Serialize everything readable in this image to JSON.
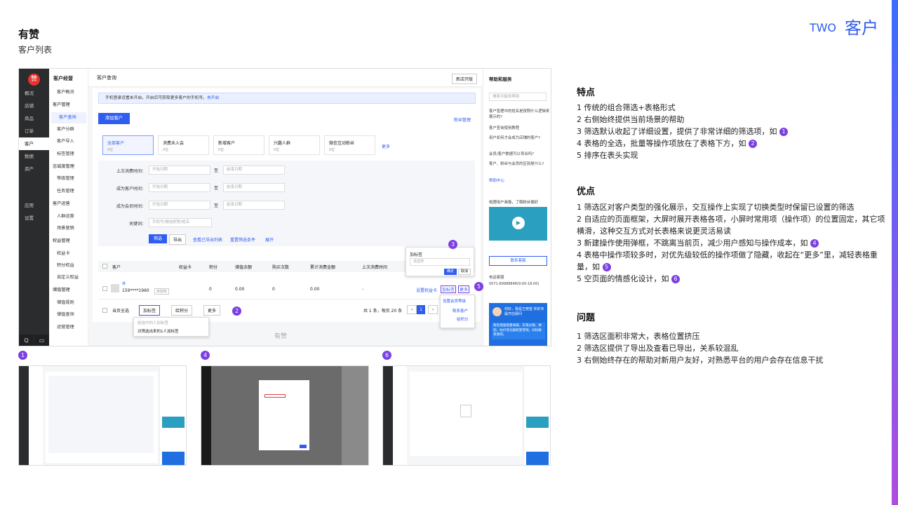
{
  "header": {
    "brand": "有赞",
    "subtitle": "客户列表",
    "tag_en": "TWO",
    "tag_cn": "客户"
  },
  "nav": {
    "logo": "赞",
    "items": [
      "概况",
      "店铺",
      "商品",
      "订单",
      "客户",
      "数据",
      "资产",
      "应用",
      "设置"
    ],
    "bottom": [
      "Q",
      "▭"
    ]
  },
  "sub": {
    "title": "客户经营",
    "items": [
      "客户概况",
      "客户管理",
      "客户查询",
      "客户分群",
      "客户导入",
      "标签管理",
      "忠诚度管理",
      "等级管理",
      "任务管理",
      "客户运营",
      "人群运营",
      "场景营销",
      "权益管理",
      "权益卡",
      "积分权益",
      "自定义权益",
      "储值管理",
      "储值规则",
      "储值查询",
      "运营管理"
    ]
  },
  "content": {
    "crumb": "客户查询",
    "new_version": "新店开版",
    "notice": "手机登录设置未开启，开启后可获取更多客户的手机号。",
    "notice_link": "去开启",
    "add_button": "添加客户",
    "fans_link": "粉丝管理",
    "tabs": [
      {
        "label": "全部客户",
        "count": "0位"
      },
      {
        "label": "消费未入会",
        "count": "0位"
      },
      {
        "label": "新增客户",
        "count": "0位"
      },
      {
        "label": "兴趣人群",
        "count": "0位"
      },
      {
        "label": "微信互动粉丝",
        "count": "0位"
      }
    ],
    "more_tabs": "更多",
    "filters": [
      {
        "label": "上次消费时间：",
        "start": "开始日期",
        "end": "结束日期"
      },
      {
        "label": "成为客户时间：",
        "start": "开始日期",
        "end": "结束日期"
      },
      {
        "label": "成为会员时间：",
        "start": "开始日期",
        "end": "结束日期"
      }
    ],
    "to": "至",
    "keyword_label": "关键词：",
    "keyword_ph": "手机号/微信昵称/姓名",
    "btn_filter": "筛选",
    "btn_export": "导出",
    "link_exported": "查看已导出列表",
    "link_reset": "重置筛选条件",
    "link_expand": "展开",
    "columns": [
      "客户",
      "权益卡",
      "积分",
      "储值余额",
      "购买次数",
      "累计消费金额",
      "上次消费时间"
    ],
    "row": {
      "name": "林",
      "phone": "159****1960",
      "badge": "未授权",
      "card": "",
      "points": "0",
      "balance": "0.00",
      "orders": "0",
      "total": "0.00",
      "last": "-"
    },
    "row_actions": [
      "设置权益卡",
      "加标签",
      "更多"
    ],
    "footer": {
      "select_all": "当页全选",
      "tag_btn": "加标签",
      "points_btn": "给积分",
      "more_btn": "更多",
      "pager": "共 1 条，每页 20 条",
      "page": "1"
    },
    "tag_menu": [
      "给选中的人加标签",
      "对筛选出来的1人加标签"
    ],
    "tag_pop": {
      "title": "加标签",
      "select": "请选择",
      "ok": "确定",
      "cancel": "取消"
    },
    "more_menu": [
      "设置会员等级",
      "联系客户",
      "给积分"
    ],
    "watermark": "有赞"
  },
  "help": {
    "title": "帮助和服务",
    "search_ph": "搜索功能和帮助",
    "items": [
      "客户管理中的姓名是按照什么逻辑来展示的?",
      "客户查询使用教程",
      "用户如何才会成为店铺的客户?",
      "会员/客户数据可以导出吗?",
      "客户、粉丝与会员的区别是什么?"
    ],
    "center": "帮助中心",
    "video_title": "梳理用户画像，了解粉丝偏好",
    "contact": "联系客服",
    "phone_label": "电话客服",
    "phone": "0571-89988848(9:00-18:00)",
    "chat_title": "你好，我是王丽莹 你的专属开店顾问",
    "chat_text": "帮您快速搭建商城，实现分销、拼团、砍价等社群裂变营销，扫码联系我吧。"
  },
  "markers": [
    "1",
    "2",
    "3",
    "4",
    "5",
    "6"
  ],
  "thumbs": [
    "1",
    "4",
    "6"
  ],
  "features": {
    "title": "特点",
    "items": [
      "1 传统的组合筛选+表格形式",
      "2 右侧始终提供当前场景的帮助",
      "3 筛选默认收起了详细设置，提供了非常详细的筛选项，如",
      "4 表格的全选，批量等操作项放在了表格下方，如",
      "5 排序在表头实现"
    ],
    "refs": [
      "1",
      "2"
    ]
  },
  "pros": {
    "title": "优点",
    "items": [
      "1 筛选区对客户类型的强化展示，交互操作上实现了切换类型时保留已设置的筛选",
      "2 自适应的页面框架，大屏时展开表格各项，小屏时常用项（操作项）的位置固定，其它项横滑，这种交互方式对长表格来说更灵活易读",
      "3 新建操作使用弹框，不跳离当前页，减少用户感知与操作成本，如",
      "4 表格中操作项较多时，对优先级较低的操作项做了隐藏，收起在“更多”里，减轻表格重量，如",
      "5 空页面的情感化设计，如"
    ],
    "refs": [
      "4",
      "5",
      "6"
    ]
  },
  "issues": {
    "title": "问题",
    "items": [
      "1 筛选区面积非常大，表格位置挤压",
      "2 筛选区提供了导出及查看已导出，关系较混乱",
      "3 右侧始终存在的帮助对新用户友好，对熟悉平台的用户会存在信息干扰"
    ]
  },
  "colors": {
    "accent": "#2f5df0",
    "marker": "#7b3fe4",
    "nav": "#2b2c2e"
  }
}
